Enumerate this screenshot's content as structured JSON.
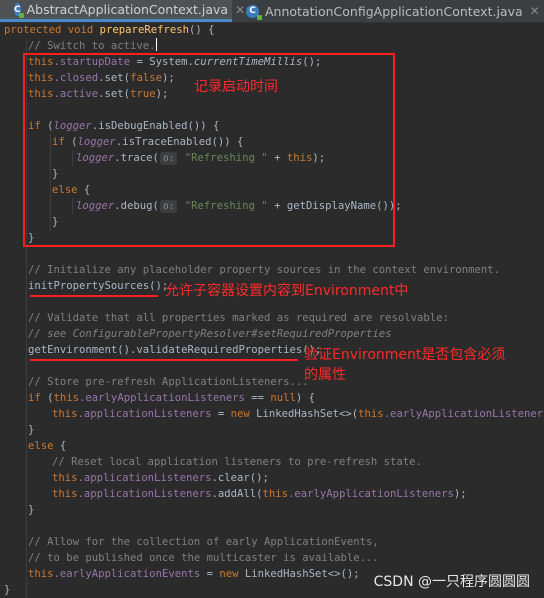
{
  "tabs": [
    {
      "title": "AbstractApplicationContext.java",
      "icon": "java-class-icon",
      "active": true
    },
    {
      "title": "AnnotationConfigApplicationContext.java",
      "icon": "java-class-icon",
      "active": false
    }
  ],
  "code": {
    "l01": {
      "a": "protected void ",
      "b": "prepareRefresh",
      "c": "() {"
    },
    "l02": "// Switch to active.",
    "l03": {
      "a": "this",
      "b": ".startupDate",
      "c": " = System.",
      "d": "currentTimeMillis",
      "e": "();"
    },
    "l04": {
      "a": "this",
      "b": ".closed",
      "c": ".set(",
      "d": "false",
      "e": ");"
    },
    "l05": {
      "a": "this",
      "b": ".active",
      "c": ".set(",
      "d": "true",
      "e": ");"
    },
    "l07": {
      "a": "if ",
      "b": "(",
      "c": "logger",
      "d": ".isDebugEnabled()) {"
    },
    "l08": {
      "a": "if ",
      "b": "(",
      "c": "logger",
      "d": ".isTraceEnabled()) {"
    },
    "l09": {
      "a": "logger",
      "b": ".trace(",
      "hint": "o:",
      "c": "\"Refreshing \"",
      "d": " + ",
      "e": "this",
      "f": ");"
    },
    "l10": "}",
    "l11": {
      "a": "else",
      "b": " {"
    },
    "l12": {
      "a": "logger",
      "b": ".debug(",
      "hint": "o:",
      "c": "\"Refreshing \"",
      "d": " + getDisplayName());"
    },
    "l13": "}",
    "l14": "}",
    "l16": "// Initialize any placeholder property sources in the context environment.",
    "l17": "initPropertySources();",
    "l19": "// Validate that all properties marked as required are resolvable:",
    "l20": "// see ConfigurablePropertyResolver#setRequiredProperties",
    "l21": "getEnvironment().validateRequiredProperties();",
    "l23": "// Store pre-refresh ApplicationListeners...",
    "l24": {
      "a": "if ",
      "b": "(",
      "c": "this",
      "d": ".earlyApplicationListeners",
      "e": " == ",
      "f": "null",
      "g": ") {"
    },
    "l25": {
      "a": "this",
      "b": ".applicationListeners",
      "c": " = ",
      "d": "new ",
      "e": "LinkedHashSet<>(",
      "f": "this",
      "g": ".earlyApplicationListeners",
      "h": ");"
    },
    "l26": "}",
    "l27": {
      "a": "else",
      "b": " {"
    },
    "l28": "// Reset local application listeners to pre-refresh state.",
    "l29": {
      "a": "this",
      "b": ".applicationListeners",
      "c": ".clear();"
    },
    "l30": {
      "a": "this",
      "b": ".applicationListeners",
      "c": ".addAll(",
      "d": "this",
      "e": ".earlyApplicationListeners",
      "f": ");"
    },
    "l31": "}",
    "l33": "// Allow for the collection of early ApplicationEvents,",
    "l34": "// to be published once the multicaster is available...",
    "l35": {
      "a": "this",
      "b": ".earlyApplicationEvents",
      "c": " = ",
      "d": "new ",
      "e": "LinkedHashSet<>();"
    },
    "l36": "}"
  },
  "annotations": {
    "record_startup_time": "记录启动时间",
    "init_property_sources": "允许子容器设置内容到Environment中",
    "validate_env_line1": "验证Environment是否包含必须",
    "validate_env_line2": "的属性"
  },
  "watermark": "CSDN @一只程序圆圆圆",
  "colors": {
    "background": "#2b2b2b",
    "keyword": "#cc7832",
    "method_decl": "#ffc66d",
    "field": "#9876aa",
    "string": "#6a8759",
    "comment": "#808080",
    "default_text": "#a9b7c6",
    "annotation_red": "#ff1e1e"
  }
}
